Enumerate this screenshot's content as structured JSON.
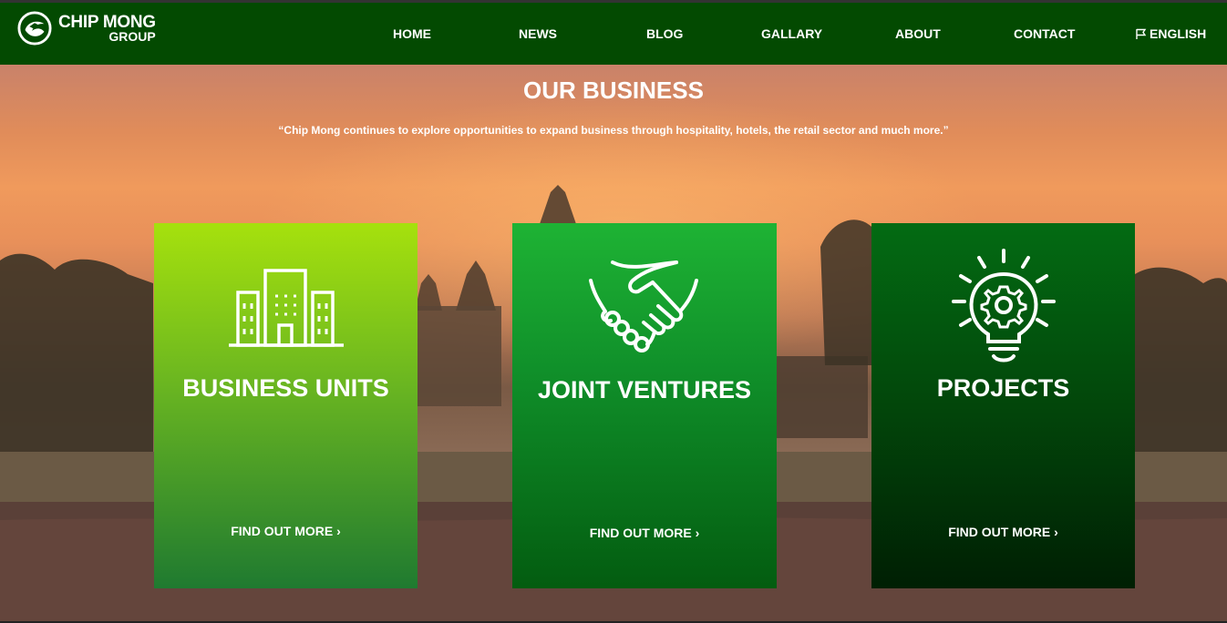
{
  "brand": {
    "line1": "CHIP MONG",
    "line2": "GROUP",
    "logo_icon": "chip-mong-logo-icon"
  },
  "nav": {
    "items": [
      {
        "label": "HOME"
      },
      {
        "label": "NEWS"
      },
      {
        "label": "BLOG"
      },
      {
        "label": "GALLARY"
      },
      {
        "label": "ABOUT"
      },
      {
        "label": "CONTACT"
      }
    ],
    "language": {
      "label": "ENGLISH",
      "icon": "flag-icon"
    }
  },
  "hero": {
    "title": "OUR BUSINESS",
    "quote": "“Chip Mong continues to explore opportunities to expand business through hospitality, hotels, the retail sector and much more.”"
  },
  "cards": [
    {
      "title": "BUSINESS UNITS",
      "link": "FIND OUT MORE ›",
      "icon": "buildings-icon"
    },
    {
      "title": "JOINT VENTURES",
      "link": "FIND OUT MORE ›",
      "icon": "handshake-icon"
    },
    {
      "title": "PROJECTS",
      "link": "FIND OUT MORE ›",
      "icon": "lightbulb-gear-icon"
    }
  ],
  "colors": {
    "nav_bg": "#034a01",
    "card1": "#a6e10d",
    "card2": "#1eb334",
    "card3": "#036b13"
  }
}
